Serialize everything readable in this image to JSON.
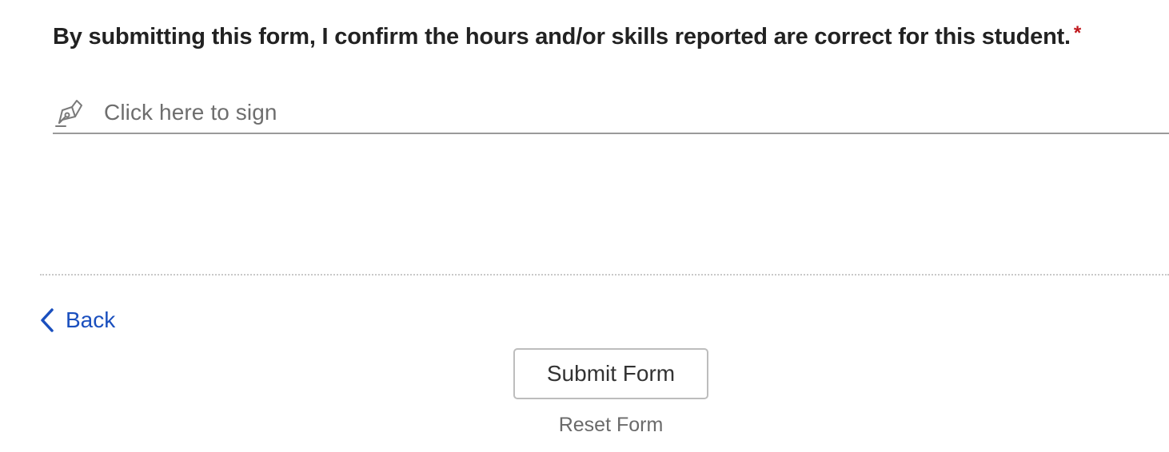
{
  "question": {
    "text": "By submitting this form, I confirm the hours and/or skills reported are correct for this student.",
    "required_marker": "*",
    "required_color": "#c0171c"
  },
  "signature": {
    "label": "Click here to sign",
    "icon": "pen-nib-icon"
  },
  "navigation": {
    "back_label": "Back",
    "back_icon": "chevron-left-icon",
    "link_color": "#1a4fbe"
  },
  "actions": {
    "submit_label": "Submit Form",
    "reset_label": "Reset Form"
  }
}
